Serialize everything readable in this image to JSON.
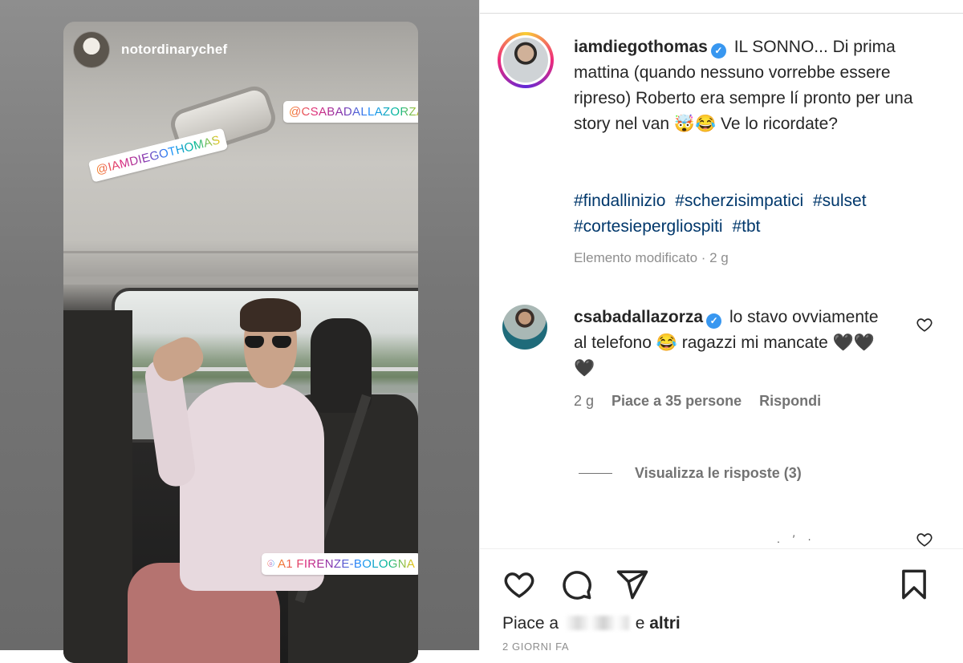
{
  "story": {
    "username": "notordinarychef",
    "stickers": [
      "@CSABADALLAZORZA",
      "@IAMDIEGOTHOMAS",
      "A1 FIRENZE-BOLOGNA"
    ]
  },
  "post": {
    "author": "iamdiegothomas",
    "caption_text": "IL SONNO... Di prima mattina (quando nessuno vorrebbe essere ripreso) Roberto era sempre lí pronto per una story nel van 🤯😂 Ve lo ricordate?",
    "hashtags": [
      "#findallinizio",
      "#scherzisimpatici",
      "#sulset",
      "#cortesiepergliospiti",
      "#tbt"
    ],
    "edited_meta": "Elemento modificato · 2 g"
  },
  "comment": {
    "author": "csabadallazorza",
    "text": "lo stavo ovviamente al telefono 😂 ragazzi mi mancate 🖤🖤🖤",
    "time": "2 g",
    "likes": "Piace a 35 persone",
    "reply_label": "Rispondi",
    "view_replies": "Visualizza le risposte (3)"
  },
  "footer": {
    "likes_prefix": "Piace a",
    "likes_suffix": "e altri",
    "date": "2 GIORNI FA"
  },
  "icons": {
    "like": "heart-icon",
    "comment": "comment-bubble-icon",
    "share": "paper-plane-icon",
    "save": "bookmark-icon",
    "verified": "verified-badge-icon"
  },
  "colors": {
    "hashtag": "#00376b",
    "verified": "#3897f0",
    "muted": "#737373"
  }
}
